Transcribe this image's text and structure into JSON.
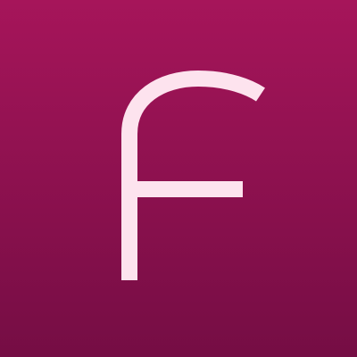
{
  "logo": {
    "letter": "F",
    "icon": "letter-f-logo-icon",
    "glyph_color": "#fde3ee",
    "background_top": "#a6155a",
    "background_bottom": "#750d44"
  }
}
